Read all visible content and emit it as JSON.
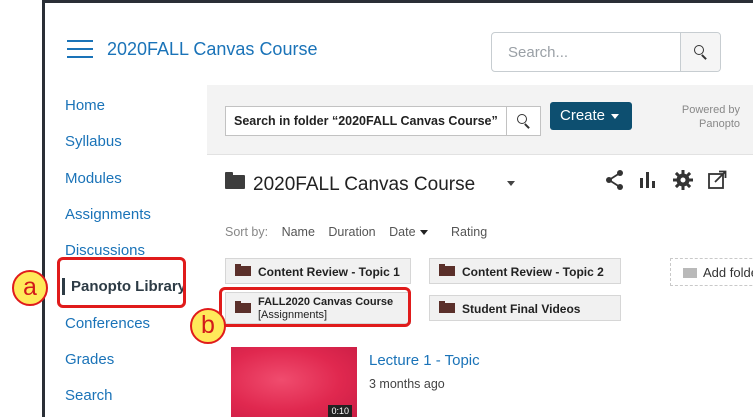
{
  "header": {
    "course_title": "2020FALL Canvas Course",
    "search_placeholder": "Search..."
  },
  "sidebar": {
    "items": [
      {
        "label": "Home"
      },
      {
        "label": "Syllabus"
      },
      {
        "label": "Modules"
      },
      {
        "label": "Assignments"
      },
      {
        "label": "Discussions"
      },
      {
        "label": "Panopto Library",
        "active": true
      },
      {
        "label": "Conferences"
      },
      {
        "label": "Grades"
      },
      {
        "label": "Search"
      }
    ]
  },
  "panopto": {
    "folder_search": "Search in folder “2020FALL Canvas Course”",
    "create_label": "Create",
    "powered_by_1": "Powered by",
    "powered_by_2": "Panopto",
    "folder_title": "2020FALL Canvas Course",
    "sort": {
      "label": "Sort by:",
      "options": [
        "Name",
        "Duration",
        "Date",
        "Rating"
      ],
      "active": "Date"
    },
    "subfolders": [
      "Content Review - Topic 1",
      "Content Review - Topic 2",
      "FALL2020 Canvas Course",
      "[Assignments]",
      "Student Final Videos"
    ],
    "add_folder": "Add folder",
    "video": {
      "title": "Lecture 1 - Topic",
      "age": "3 months ago",
      "duration": "0:10"
    }
  },
  "annotations": {
    "a": "a",
    "b": "b",
    "highlight_color": "#e01b1b",
    "badge_color": "#ffe95a"
  },
  "colors": {
    "link": "#1a73b8",
    "create_button": "#0d4f70"
  }
}
